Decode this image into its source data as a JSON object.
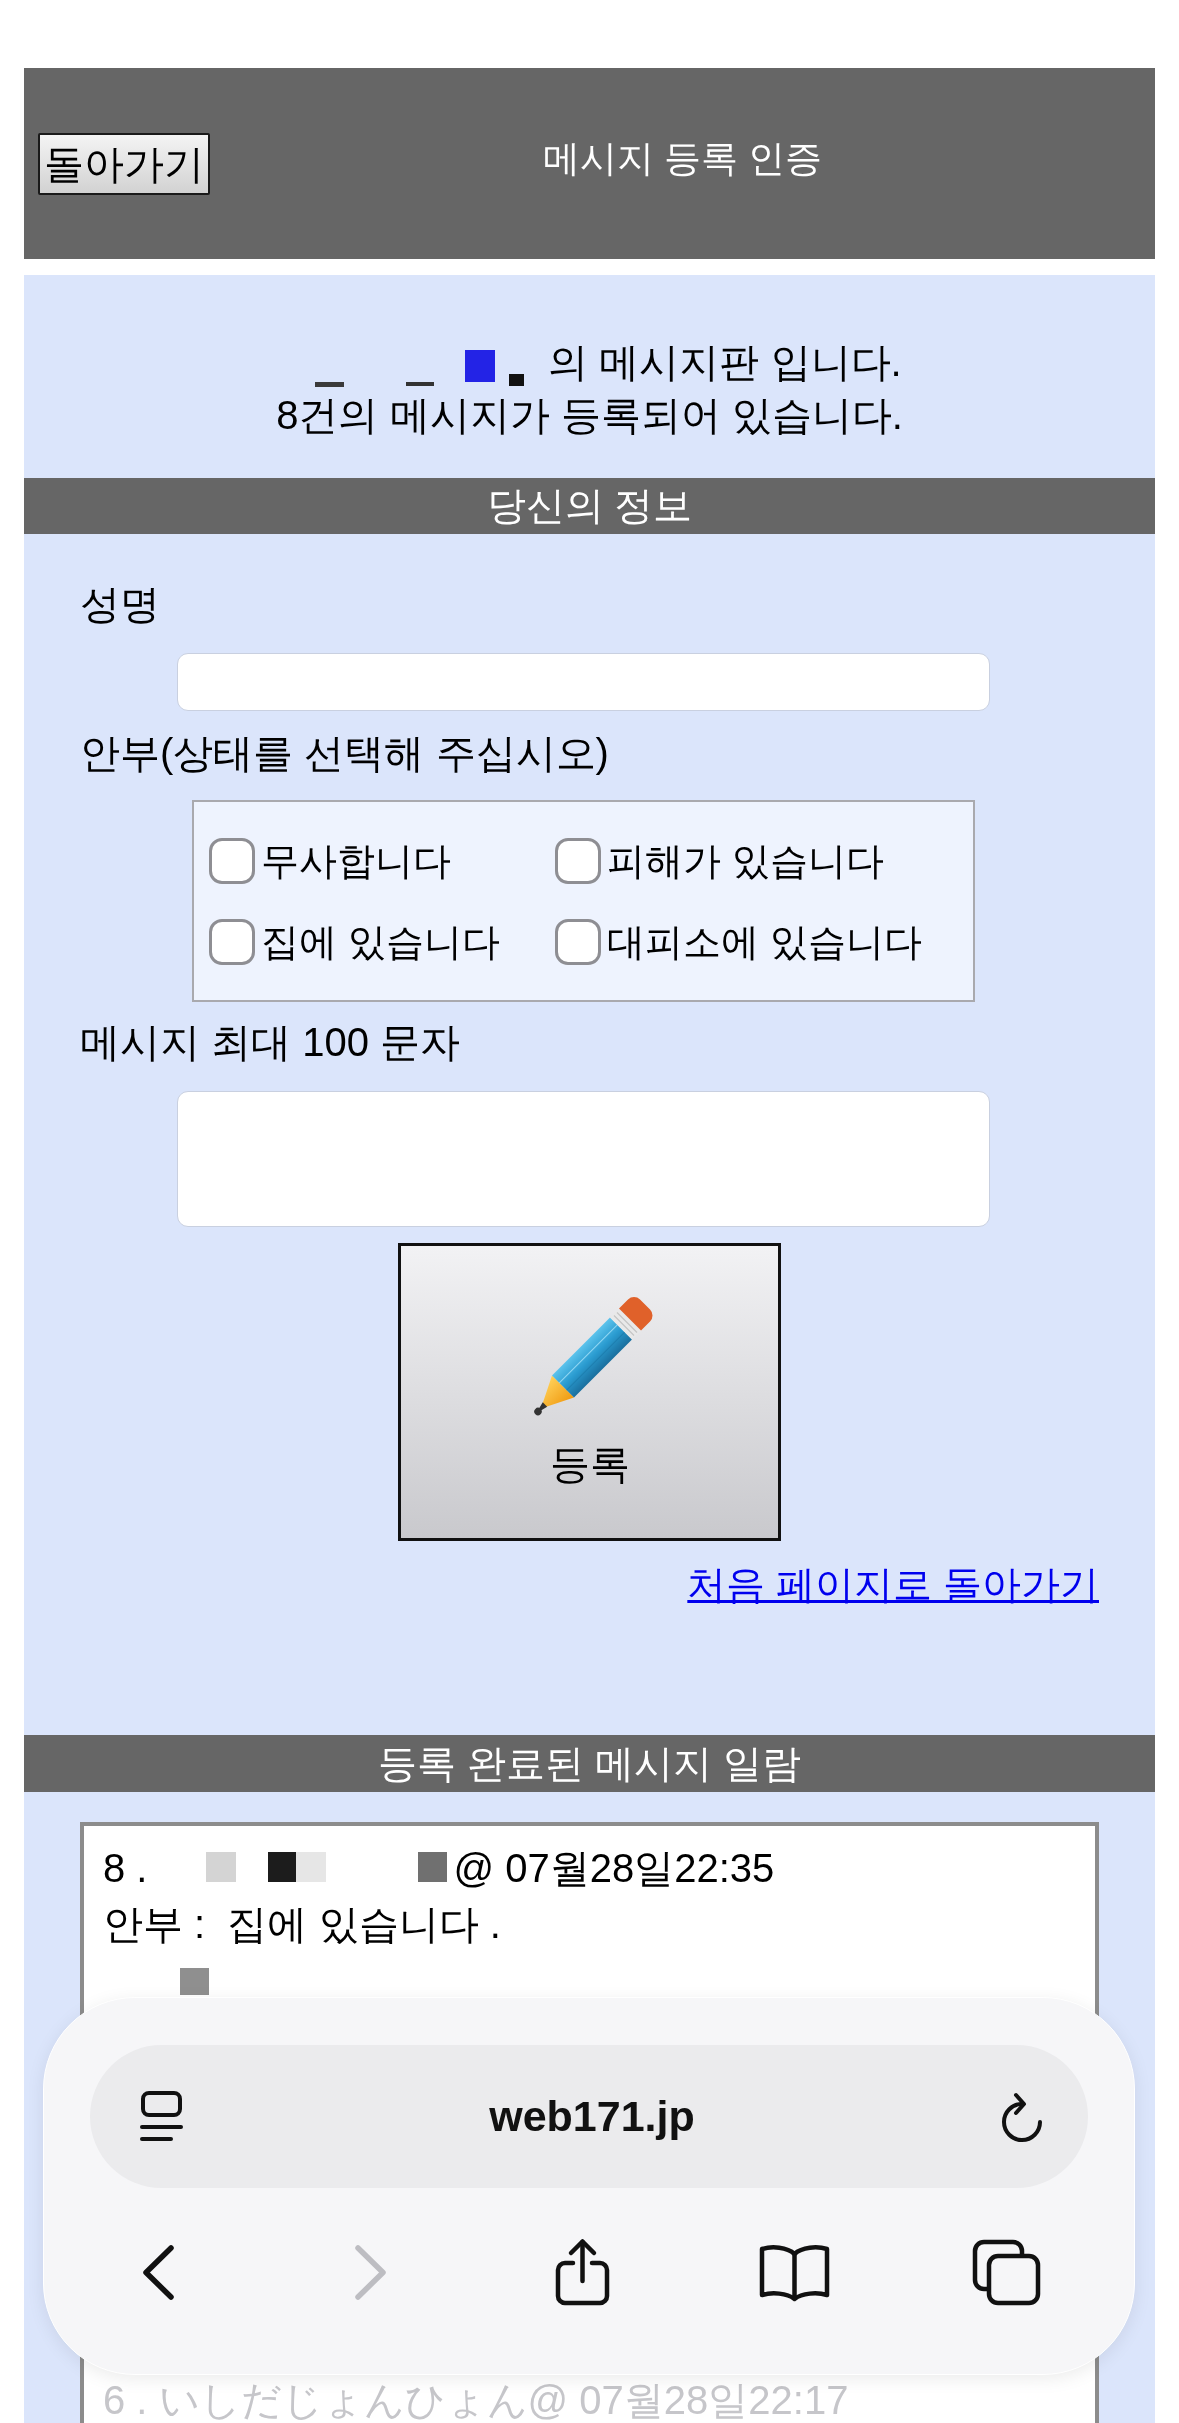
{
  "header": {
    "back_button": "돌아가기",
    "title": "메시지 등록 인증"
  },
  "intro": {
    "board_line": "의 메시지판 입니다.",
    "count_line": "8건의 메시지가 등록되어 있습니다."
  },
  "your_info": {
    "heading": "당신의 정보",
    "name_label": "성명",
    "status_label": "안부(상태를 선택해 주십시오)",
    "status_options": [
      {
        "label": "무사합니다",
        "checked": false
      },
      {
        "label": "피해가 있습니다",
        "checked": false
      },
      {
        "label": "집에 있습니다",
        "checked": false
      },
      {
        "label": "대피소에 있습니다",
        "checked": false
      }
    ],
    "message_label": "메시지 최대 100 문자",
    "submit_button": "등록",
    "home_link": "처음 페이지로 돌아가기"
  },
  "message_list": {
    "heading": "등록 완료된 메시지 일람",
    "messages": [
      {
        "number": "8 .",
        "posted": "@ 07월28일22:35",
        "status": "안부 :  집에 있습니다 ."
      }
    ],
    "messages_behind_toolbar": [
      {
        "header": "6 . いしだじょんひょん@ 07월28일22:17"
      }
    ]
  },
  "browser_toolbar": {
    "url": "web171.jp"
  }
}
